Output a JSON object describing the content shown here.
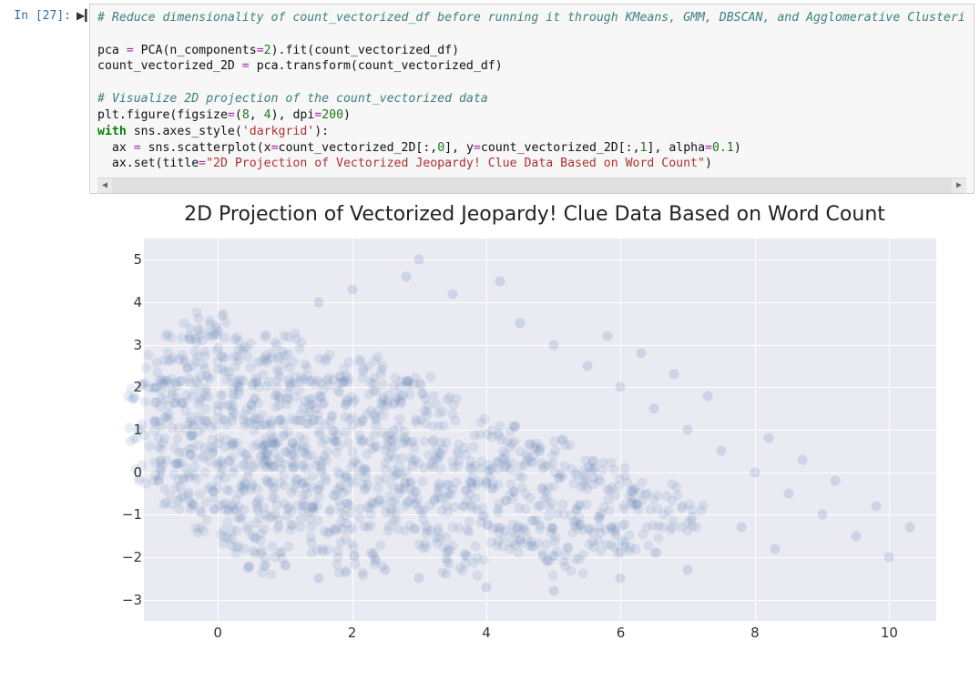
{
  "cell": {
    "prompt": "In [27]:",
    "run_icon": "▶▎",
    "code": {
      "comment1": "# Reduce dimensionality of count_vectorized_df before running it through KMeans, GMM, DBSCAN, and Agglomerative Clusteri",
      "l2a": "pca ",
      "l2b": "=",
      "l2c": " PCA(n_components",
      "l2d": "=",
      "l2e": "2",
      "l2f": ").fit(count_vectorized_df)",
      "l3a": "count_vectorized_2D ",
      "l3b": "=",
      "l3c": " pca.transform(count_vectorized_df)",
      "comment2": "# Visualize 2D projection of the count_vectorized data",
      "l5a": "plt.figure(figsize",
      "l5b": "=",
      "l5c": "(",
      "l5d": "8",
      "l5e": ", ",
      "l5f": "4",
      "l5g": "), dpi",
      "l5h": "=",
      "l5i": "200",
      "l5j": ")",
      "l6a": "with",
      "l6b": " sns.axes_style(",
      "l6c": "'darkgrid'",
      "l6d": "):",
      "l7a": "  ax ",
      "l7b": "=",
      "l7c": " sns.scatterplot(x",
      "l7d": "=",
      "l7e": "count_vectorized_2D[:,",
      "l7f": "0",
      "l7g": "], y",
      "l7h": "=",
      "l7i": "count_vectorized_2D[:,",
      "l7j": "1",
      "l7k": "], alpha",
      "l7l": "=",
      "l7m": "0.1",
      "l7n": ")",
      "l8a": "  ax.set(title",
      "l8b": "=",
      "l8c": "\"2D Projection of Vectorized Jeopardy! Clue Data Based on Word Count\"",
      "l8d": ")"
    },
    "scroll_left": "◀",
    "scroll_right": "▶"
  },
  "chart_data": {
    "type": "scatter",
    "title": "2D Projection of Vectorized Jeopardy! Clue Data Based on Word Count",
    "xlabel": "",
    "ylabel": "",
    "yticks": [
      5,
      4,
      3,
      2,
      1,
      0,
      -1,
      -2,
      -3
    ],
    "xticks": [
      0,
      2,
      4,
      6,
      8,
      10
    ],
    "xlim": [
      -1.1,
      10.7
    ],
    "ylim": [
      -3.5,
      5.5
    ],
    "grid": true,
    "style": "darkgrid",
    "alpha": 0.1,
    "cluster_centers": [
      {
        "x": 0.0,
        "y": 3.6
      },
      {
        "x": 0.4,
        "y": 3.1
      },
      {
        "x": 0.8,
        "y": 2.6
      },
      {
        "x": -0.3,
        "y": 3.1
      },
      {
        "x": 0.1,
        "y": 2.6
      },
      {
        "x": 0.5,
        "y": 2.1
      },
      {
        "x": -0.6,
        "y": 2.6
      },
      {
        "x": -0.2,
        "y": 2.1
      },
      {
        "x": 0.2,
        "y": 1.6
      },
      {
        "x": 0.6,
        "y": 1.1
      },
      {
        "x": 1.0,
        "y": 0.6
      },
      {
        "x": -0.9,
        "y": 2.1
      },
      {
        "x": -0.5,
        "y": 1.6
      },
      {
        "x": -0.1,
        "y": 1.1
      },
      {
        "x": 0.3,
        "y": 0.6
      },
      {
        "x": 0.7,
        "y": 0.1
      },
      {
        "x": -0.8,
        "y": 1.1
      },
      {
        "x": -0.4,
        "y": 0.6
      },
      {
        "x": 0.0,
        "y": 0.1
      },
      {
        "x": 0.4,
        "y": -0.4
      },
      {
        "x": 0.8,
        "y": -0.9
      },
      {
        "x": -0.7,
        "y": 0.1
      },
      {
        "x": -0.3,
        "y": -0.4
      },
      {
        "x": 0.1,
        "y": -0.9
      },
      {
        "x": 0.5,
        "y": -1.4
      },
      {
        "x": 0.9,
        "y": -1.9
      },
      {
        "x": 1.1,
        "y": 3.1
      },
      {
        "x": 1.5,
        "y": 2.6
      },
      {
        "x": 1.9,
        "y": 2.1
      },
      {
        "x": 1.2,
        "y": 2.1
      },
      {
        "x": 1.6,
        "y": 1.6
      },
      {
        "x": 2.0,
        "y": 1.1
      },
      {
        "x": 0.9,
        "y": 1.6
      },
      {
        "x": 1.3,
        "y": 1.1
      },
      {
        "x": 1.7,
        "y": 0.6
      },
      {
        "x": 2.1,
        "y": 0.1
      },
      {
        "x": 1.0,
        "y": 0.6
      },
      {
        "x": 1.4,
        "y": 0.1
      },
      {
        "x": 1.8,
        "y": -0.4
      },
      {
        "x": 2.2,
        "y": -0.9
      },
      {
        "x": 1.1,
        "y": -0.4
      },
      {
        "x": 1.5,
        "y": -0.9
      },
      {
        "x": 1.9,
        "y": -1.4
      },
      {
        "x": 2.3,
        "y": -1.9
      },
      {
        "x": 2.3,
        "y": 2.6
      },
      {
        "x": 2.7,
        "y": 2.1
      },
      {
        "x": 2.4,
        "y": 1.6
      },
      {
        "x": 2.8,
        "y": 1.1
      },
      {
        "x": 3.2,
        "y": 0.6
      },
      {
        "x": 2.5,
        "y": 0.6
      },
      {
        "x": 2.9,
        "y": 0.1
      },
      {
        "x": 3.3,
        "y": -0.4
      },
      {
        "x": 2.6,
        "y": -0.4
      },
      {
        "x": 3.0,
        "y": -0.9
      },
      {
        "x": 3.4,
        "y": -1.4
      },
      {
        "x": 3.8,
        "y": -1.9
      },
      {
        "x": 3.1,
        "y": 2.1
      },
      {
        "x": 3.5,
        "y": 1.6
      },
      {
        "x": 3.6,
        "y": 0.6
      },
      {
        "x": 4.0,
        "y": 0.1
      },
      {
        "x": 3.7,
        "y": -0.4
      },
      {
        "x": 4.1,
        "y": -0.9
      },
      {
        "x": 4.5,
        "y": -1.4
      },
      {
        "x": 4.3,
        "y": 1.1
      },
      {
        "x": 4.7,
        "y": 0.6
      },
      {
        "x": 4.4,
        "y": 0.1
      },
      {
        "x": 4.8,
        "y": -0.4
      },
      {
        "x": 5.2,
        "y": -0.9
      },
      {
        "x": 4.9,
        "y": -1.4
      },
      {
        "x": 5.3,
        "y": -1.9
      },
      {
        "x": 5.1,
        "y": 0.6
      },
      {
        "x": 5.5,
        "y": 0.1
      },
      {
        "x": 5.6,
        "y": -0.9
      },
      {
        "x": 6.0,
        "y": -1.4
      },
      {
        "x": 5.9,
        "y": 0.1
      },
      {
        "x": 6.3,
        "y": -0.4
      },
      {
        "x": 6.4,
        "y": -1.4
      },
      {
        "x": 6.7,
        "y": -0.4
      },
      {
        "x": 7.1,
        "y": -0.9
      }
    ],
    "sparse_points": [
      {
        "x": 2.0,
        "y": 4.3
      },
      {
        "x": 2.8,
        "y": 4.6
      },
      {
        "x": 3.0,
        "y": 5.0
      },
      {
        "x": 3.5,
        "y": 4.2
      },
      {
        "x": 4.2,
        "y": 4.5
      },
      {
        "x": 1.5,
        "y": 4.0
      },
      {
        "x": 4.5,
        "y": 3.5
      },
      {
        "x": 5.0,
        "y": 3.0
      },
      {
        "x": 5.5,
        "y": 2.5
      },
      {
        "x": 6.0,
        "y": 2.0
      },
      {
        "x": 6.5,
        "y": 1.5
      },
      {
        "x": 7.0,
        "y": 1.0
      },
      {
        "x": 7.5,
        "y": 0.5
      },
      {
        "x": 8.0,
        "y": 0.0
      },
      {
        "x": 8.5,
        "y": -0.5
      },
      {
        "x": 9.0,
        "y": -1.0
      },
      {
        "x": 9.5,
        "y": -1.5
      },
      {
        "x": 10.0,
        "y": -2.0
      },
      {
        "x": 8.2,
        "y": 0.8
      },
      {
        "x": 8.7,
        "y": 0.3
      },
      {
        "x": 9.2,
        "y": -0.2
      },
      {
        "x": 7.3,
        "y": 1.8
      },
      {
        "x": 6.8,
        "y": 2.3
      },
      {
        "x": 7.8,
        "y": -1.3
      },
      {
        "x": 8.3,
        "y": -1.8
      },
      {
        "x": 2.5,
        "y": -2.3
      },
      {
        "x": 3.0,
        "y": -2.5
      },
      {
        "x": 4.0,
        "y": -2.7
      },
      {
        "x": 5.0,
        "y": -2.8
      },
      {
        "x": 6.0,
        "y": -2.5
      },
      {
        "x": 7.0,
        "y": -2.3
      },
      {
        "x": 1.5,
        "y": -2.5
      },
      {
        "x": 9.8,
        "y": -0.8
      },
      {
        "x": 10.3,
        "y": -1.3
      },
      {
        "x": 5.8,
        "y": 3.2
      },
      {
        "x": 6.3,
        "y": 2.8
      }
    ]
  }
}
